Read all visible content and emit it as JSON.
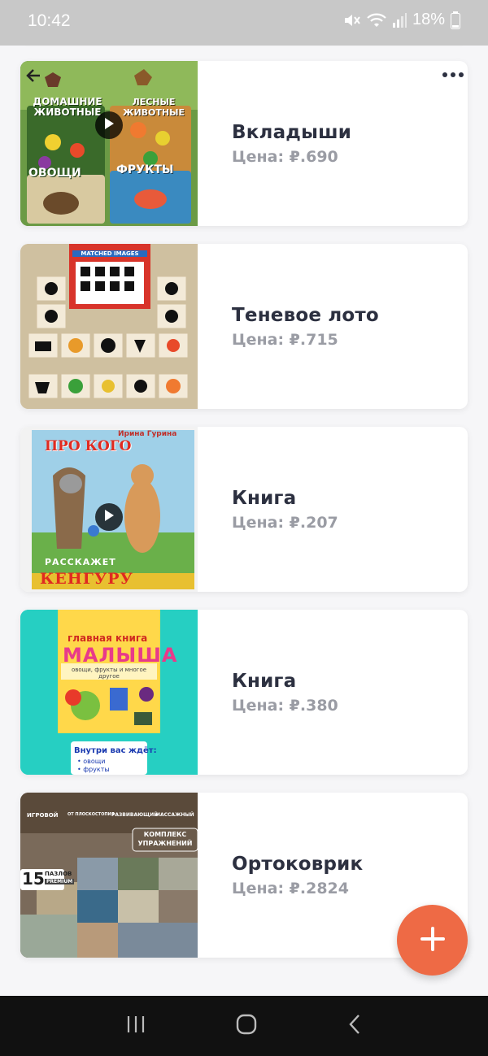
{
  "status": {
    "time": "10:42",
    "battery": "18%"
  },
  "items": [
    {
      "title": "Вкладыши",
      "price": "Цена: ₽.690",
      "has_video": true
    },
    {
      "title": "Теневое лото",
      "price": "Цена: ₽.715",
      "has_video": false
    },
    {
      "title": "Книга",
      "price": "Цена: ₽.207",
      "has_video": true
    },
    {
      "title": "Книга",
      "price": "Цена: ₽.380",
      "has_video": false
    },
    {
      "title": "Ортоковрик",
      "price": "Цена: ₽.2824",
      "has_video": false
    }
  ],
  "thumbs": {
    "item0": {
      "top_left": "ДОМАШНИЕ ЖИВОТНЫЕ",
      "top_right": "ЛЕСНЫЕ ЖИВОТНЫЕ",
      "bottom_left": "ОВОЩИ",
      "bottom_right": "ФРУКТЫ"
    },
    "item1": {
      "box_label": "MATCHED IMAGES"
    },
    "item2": {
      "author": "Ирина Гурина",
      "title_top": "ПРО КОГО",
      "title_mid": "РАССКАЖЕТ",
      "title_bottom": "КЕНГУРУ"
    },
    "item3": {
      "title_small": "главная книга",
      "title_big": "МАЛЫША",
      "subtitle": "овощи, фрукты и многое другое",
      "inside": "Внутри вас ждёт:",
      "bullet1": "• овощи",
      "bullet2": "• фрукты"
    },
    "item4": {
      "tag1": "ИГРОВОЙ",
      "tag2": "ОТ ПЛОСКОСТОПИЯ",
      "tag3": "РАЗВИВАЮЩИЙ",
      "tag4": "МАССАЖНЫЙ",
      "badge": "КОМПЛЕКС УПРАЖНЕНИЙ",
      "count": "15",
      "count_label": "ПАЗЛОВ",
      "premium": "PREMIUM"
    }
  },
  "fab": {
    "label": "+"
  },
  "colors": {
    "accent": "#ee6a45",
    "title": "#2c3040",
    "price": "#9a9ca4"
  },
  "icons": [
    "mute-icon",
    "wifi-icon",
    "signal-icon",
    "battery-icon",
    "play-icon",
    "more-icon",
    "plus-icon",
    "recent-apps-icon",
    "home-icon",
    "back-icon"
  ]
}
